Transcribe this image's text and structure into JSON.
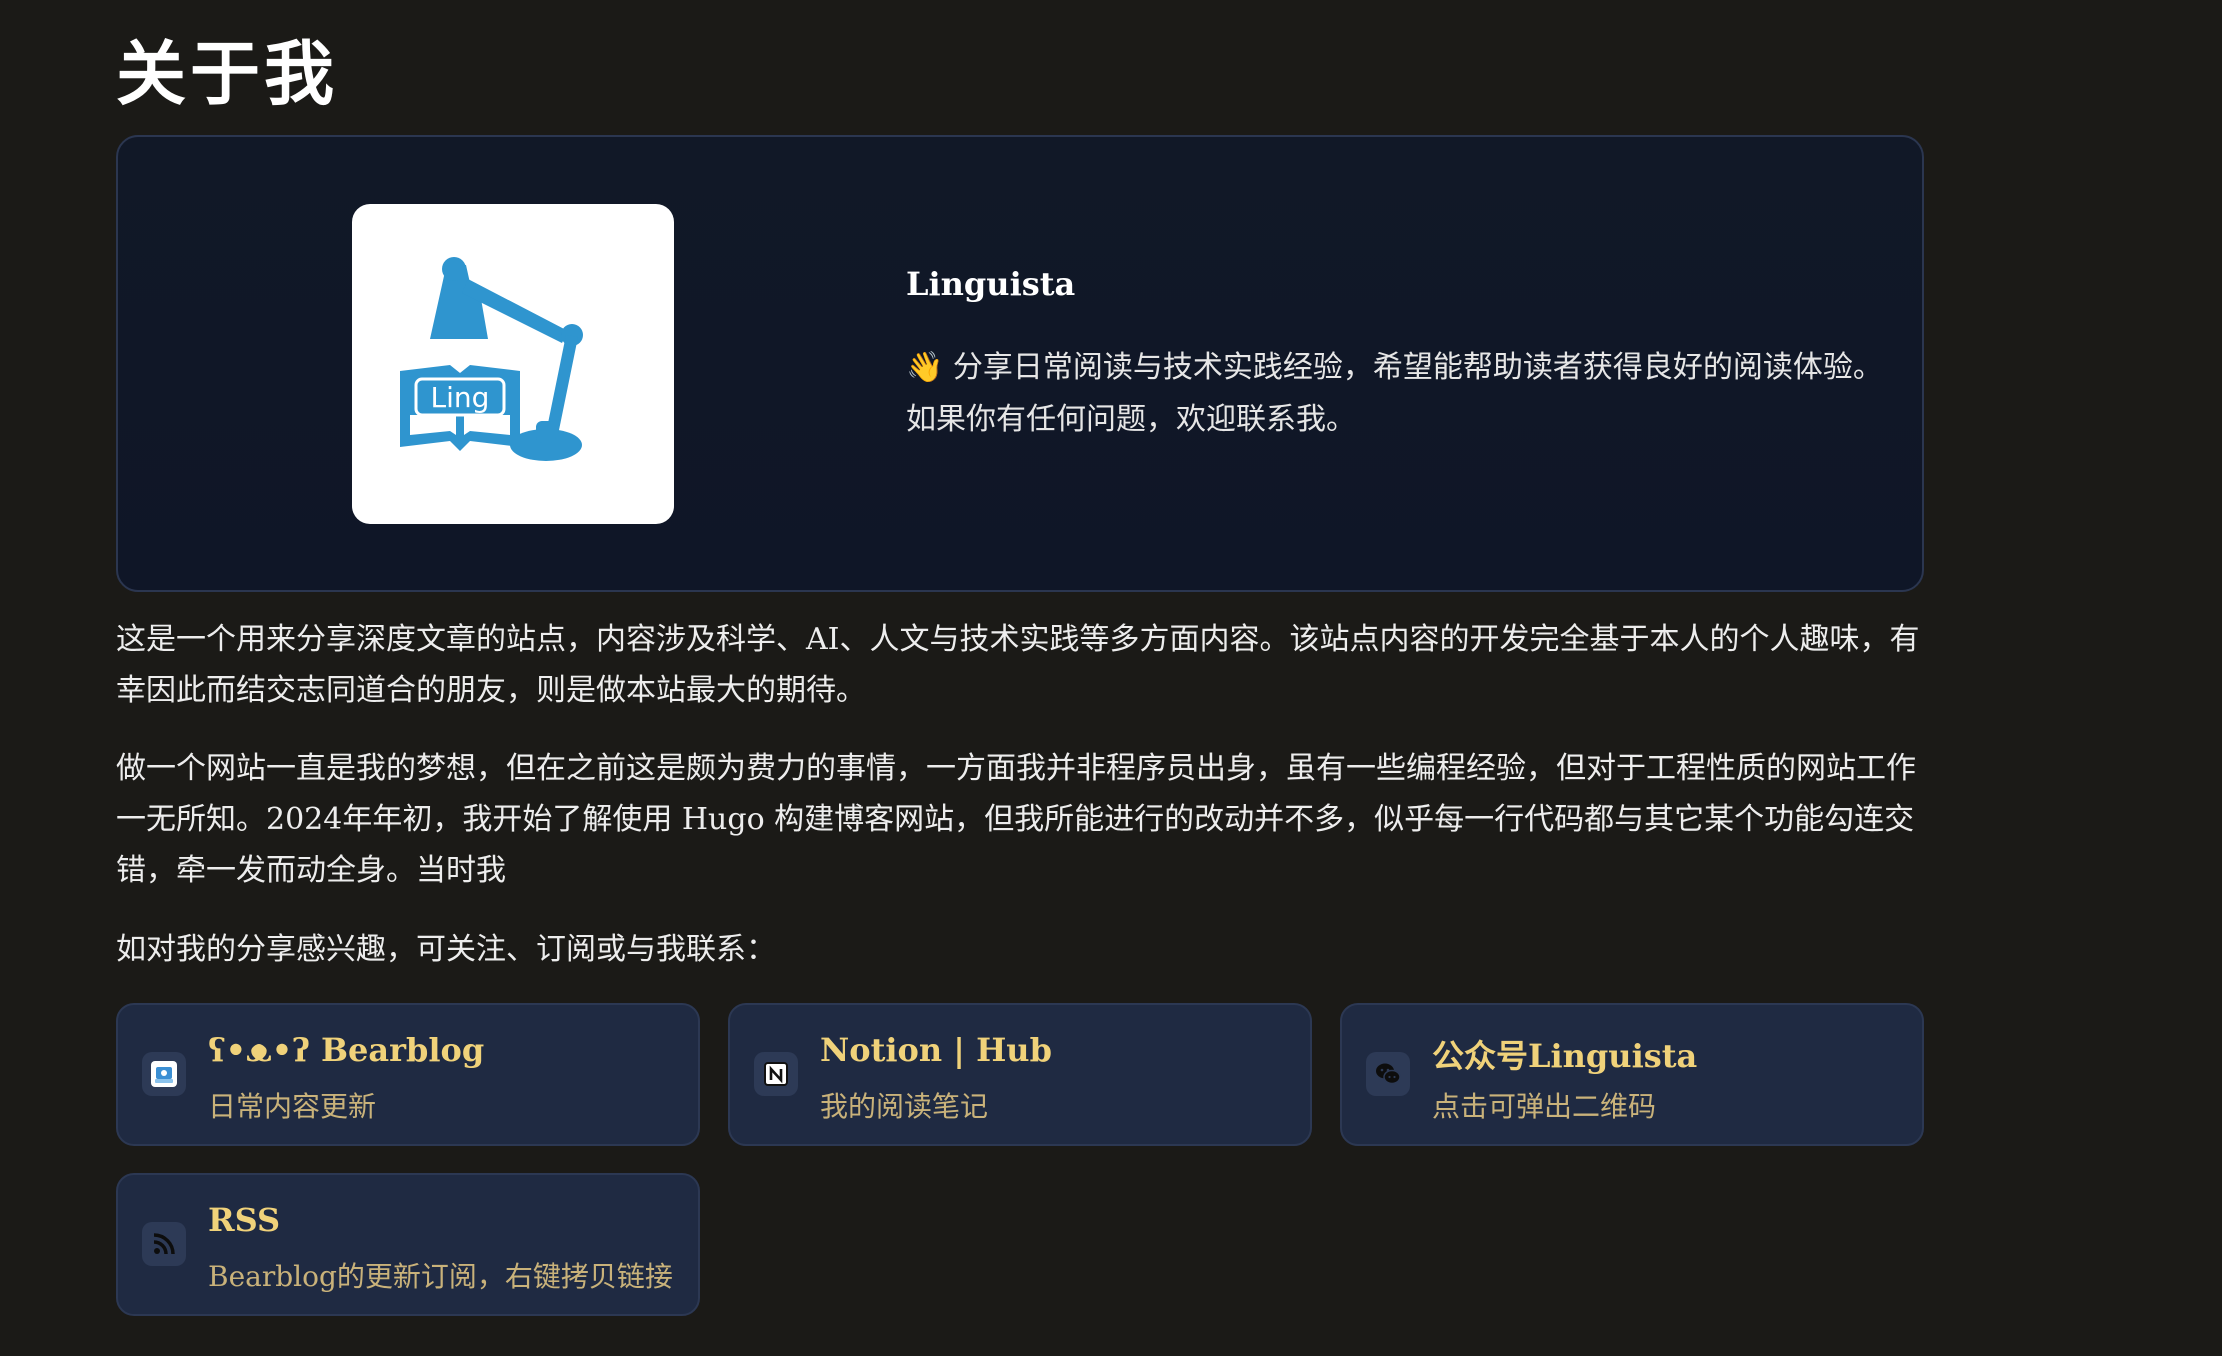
{
  "page": {
    "title": "关于我"
  },
  "hero": {
    "logo_text": "Ling",
    "name": "Linguista",
    "bio": "👋 分享日常阅读与技术实践经验，希望能帮助读者获得良好的阅读体验。如果你有任何问题，欢迎联系我。"
  },
  "paragraphs": {
    "intro": "这是一个用来分享深度文章的站点，内容涉及科学、AI、人文与技术实践等多方面内容。该站点内容的开发完全基于本人的个人趣味，有幸因此而结交志同道合的朋友，则是做本站最大的期待。",
    "story": "做一个网站一直是我的梦想，但在之前这是颇为费力的事情，一方面我并非程序员出身，虽有一些编程经验，但对于工程性质的网站工作一无所知。2024年年初，我开始了解使用 Hugo 构建博客网站，但我所能进行的改动并不多，似乎每一行代码都与其它某个功能勾连交错，牵一发而动全身。当时我",
    "follow": "如对我的分享感兴趣，可关注、订阅或与我联系："
  },
  "links": [
    {
      "title": "ʕ•ᴥ•ʔ Bearblog",
      "subtitle": "日常内容更新",
      "icon": "bearblog-icon"
    },
    {
      "title": "Notion | Hub",
      "subtitle": "我的阅读笔记",
      "icon": "notion-icon"
    },
    {
      "title": "公众号Linguista",
      "subtitle": "点击可弹出二维码",
      "icon": "wechat-icon"
    },
    {
      "title": "RSS",
      "subtitle": "Bearblog的更新订阅，右键拷贝链接",
      "icon": "rss-icon"
    }
  ],
  "colors": {
    "background": "#1b1a17",
    "card_background": "#1f2a42",
    "card_title": "#f0d27a",
    "card_subtitle": "#c9b27a",
    "logo_blue": "#2f95cf"
  }
}
